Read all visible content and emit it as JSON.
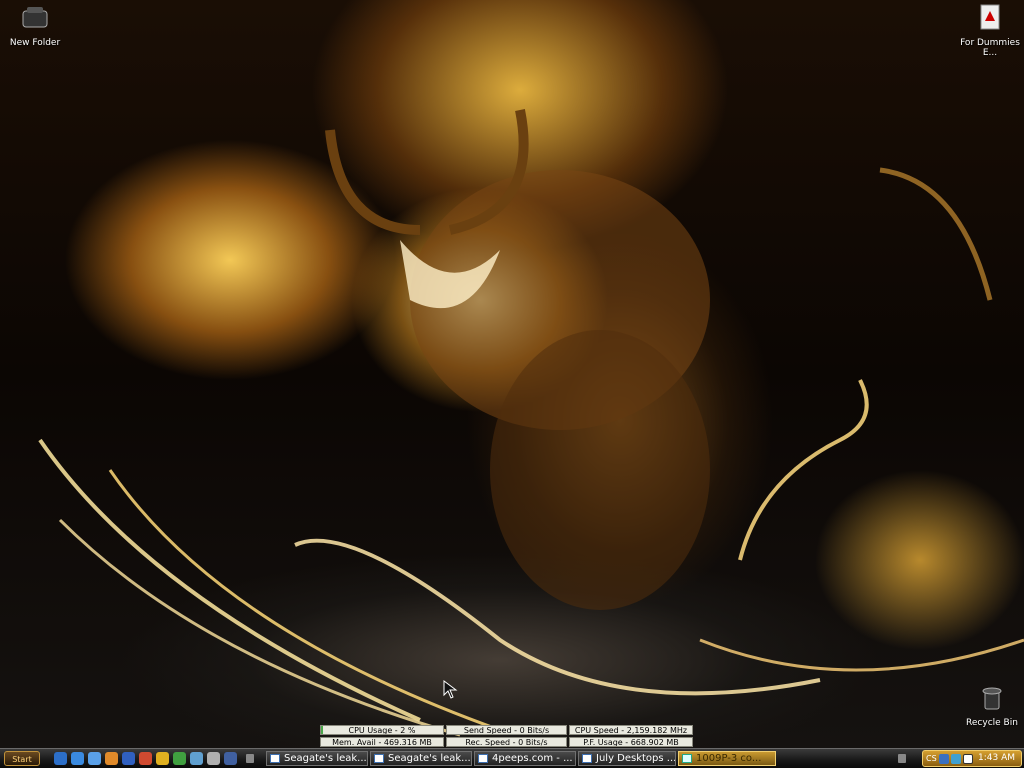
{
  "desktop": {
    "icons": [
      {
        "label": "New Folder"
      },
      {
        "label": "For Dummies E..."
      },
      {
        "label": "Recycle Bin"
      }
    ]
  },
  "meters": {
    "cpu_usage": "CPU Usage - 2 %",
    "cpu_usage_level": 0.02,
    "mem_avail": "Mem. Avail - 469.316 MB",
    "send_speed": "Send Speed - 0 Bits/s",
    "rec_speed": "Rec. Speed - 0 Bits/s",
    "cpu_speed": "CPU Speed - 2,159.182 MHz",
    "pf_usage": "P.F. Usage - 668.902 MB"
  },
  "taskbar": {
    "start_label": "Start",
    "quick_launch": [
      "ql-1",
      "ql-2",
      "ql-3",
      "ql-4",
      "ql-5",
      "ql-6",
      "ql-7",
      "ql-8",
      "ql-9",
      "ql-10",
      "ql-11"
    ],
    "tasks": [
      {
        "label": "Seagate's leak..."
      },
      {
        "label": "Seagate's leak..."
      },
      {
        "label": "4peeps.com - ..."
      },
      {
        "label": "July Desktops ..."
      },
      {
        "label": "1009P-3 co..."
      }
    ],
    "clock": "1:43 AM",
    "tray_text": "CS"
  },
  "colors": {
    "accent": "#d6a030",
    "taskbar": "#1a1a1a"
  }
}
